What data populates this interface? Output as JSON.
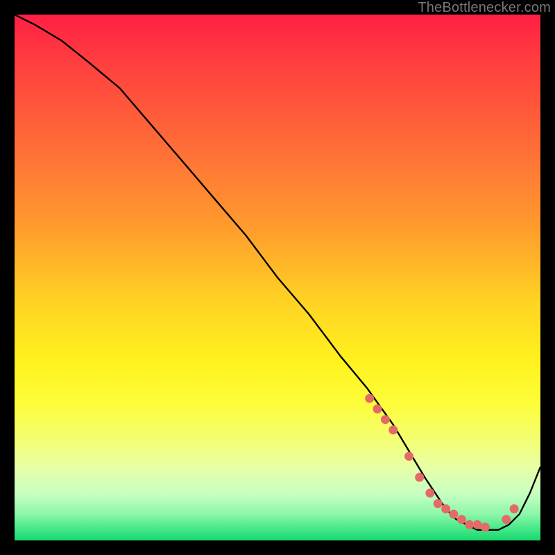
{
  "watermark": "TheBottlenecker.com",
  "chart_data": {
    "type": "line",
    "title": "",
    "xlabel": "",
    "ylabel": "",
    "xlim": [
      0,
      100
    ],
    "ylim": [
      0,
      100
    ],
    "x": [
      0,
      4,
      9,
      14,
      20,
      26,
      32,
      38,
      44,
      50,
      56,
      62,
      67,
      72,
      75,
      78,
      80,
      82,
      84,
      86,
      88,
      90,
      92,
      94,
      96,
      98,
      100
    ],
    "values": [
      100,
      98,
      95,
      91,
      86,
      79,
      72,
      65,
      58,
      50,
      43,
      35,
      29,
      22,
      17,
      12,
      9,
      6,
      4,
      3,
      2,
      2,
      2,
      3,
      5,
      9,
      14
    ],
    "markers": {
      "x": [
        67.5,
        69,
        70.5,
        72,
        75,
        77,
        79,
        80.5,
        82,
        83.5,
        85,
        86.5,
        88,
        89.5,
        93.5,
        95
      ],
      "values": [
        27,
        25,
        23,
        21,
        16,
        12,
        9,
        7,
        6,
        5,
        4,
        3,
        3,
        2.5,
        4,
        6
      ]
    },
    "gradient_stops": [
      {
        "pos": 0,
        "color": "#ff1f44"
      },
      {
        "pos": 24,
        "color": "#ff6a38"
      },
      {
        "pos": 55,
        "color": "#ffd423"
      },
      {
        "pos": 80,
        "color": "#f5fe6b"
      },
      {
        "pos": 95,
        "color": "#8cf7a9"
      },
      {
        "pos": 100,
        "color": "#18d86f"
      }
    ]
  }
}
